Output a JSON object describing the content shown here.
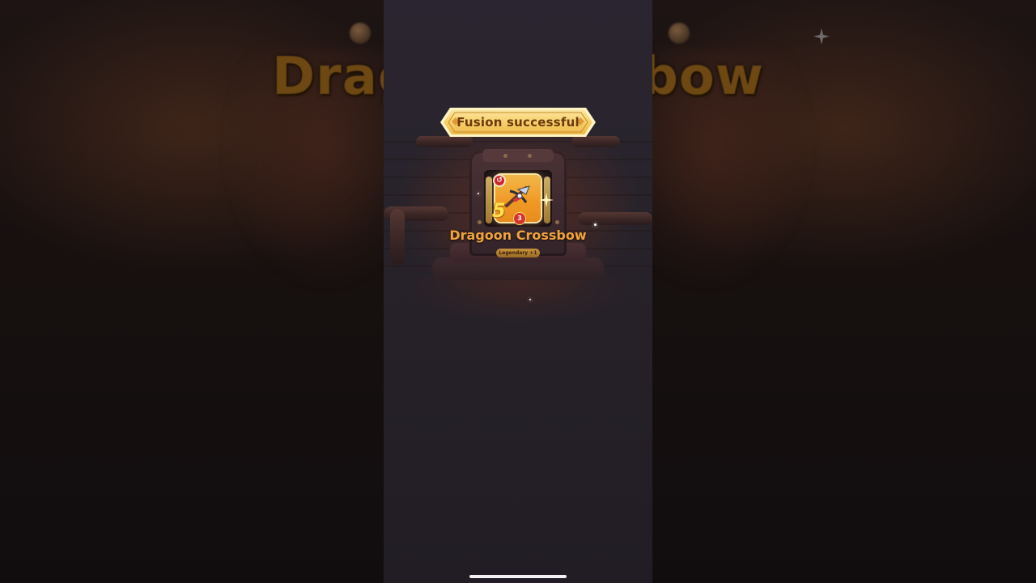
{
  "background": {
    "title_left_fragment": "Drag",
    "title_right_fragment": "bow"
  },
  "banner": {
    "text": "Fusion successful"
  },
  "item": {
    "name": "Dragoon Crossbow",
    "rarity": "Legendary +1",
    "level": "5",
    "stars": "3",
    "badge": "↺"
  },
  "colors": {
    "banner_fill": "#f8d675",
    "banner_text": "#6a3a0c",
    "item_name": "#f2a43a",
    "card_orange": "#f09a26",
    "background": "#2a2530"
  },
  "icons": {
    "banner_left_gem": "diamond-icon",
    "banner_right_gem": "diamond-icon",
    "sparkle": "sparkle-icon",
    "crossbow": "crossbow-icon"
  }
}
